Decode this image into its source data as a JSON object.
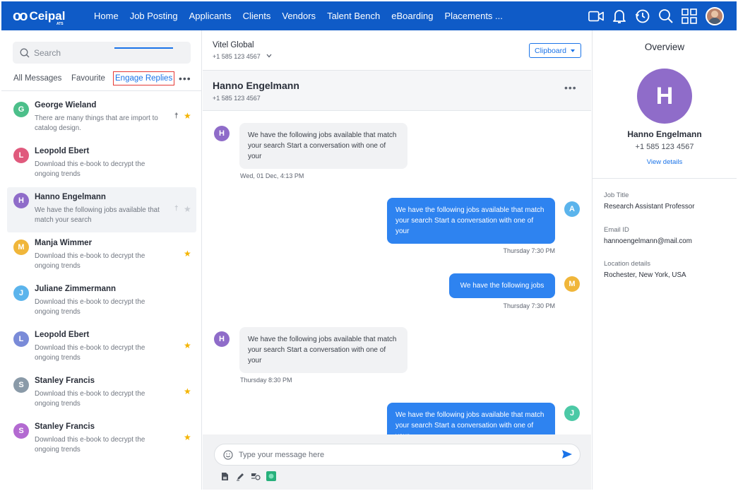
{
  "brand": {
    "name": "Ceipal",
    "sub": "ATS"
  },
  "nav": [
    "Home",
    "Job Posting",
    "Applicants",
    "Clients",
    "Vendors",
    "Talent Bench",
    "eBoarding",
    "Placements ..."
  ],
  "nav_icons": [
    "video-icon",
    "bell-icon",
    "history-icon",
    "search-icon",
    "grid-icon",
    "avatar"
  ],
  "sidebar": {
    "search_placeholder": "Search",
    "tabs": [
      "All Messages",
      "Favourite",
      "Engage Replies"
    ],
    "active_tab": "Engage Replies",
    "contacts": [
      {
        "initial": "G",
        "color": "#4cbf8a",
        "name": "George Wieland",
        "preview": "There are many things that are import to catalog design.",
        "pinned": true,
        "starred": true,
        "selected": false
      },
      {
        "initial": "L",
        "color": "#e05a7d",
        "name": "Leopold Ebert",
        "preview": "Download this e-book to decrypt the ongoing trends",
        "pinned": false,
        "starred": false,
        "selected": false
      },
      {
        "initial": "H",
        "color": "#8f6cc9",
        "name": "Hanno Engelmann",
        "preview": "We have the following jobs available that match your search",
        "pinned": true,
        "starred": true,
        "selected": true
      },
      {
        "initial": "M",
        "color": "#f0b63a",
        "name": "Manja Wimmer",
        "preview": "Download this e-book to decrypt the ongoing trends",
        "pinned": false,
        "starred": true,
        "selected": false
      },
      {
        "initial": "J",
        "color": "#5bb4ec",
        "name": "Juliane Zimmermann",
        "preview": "Download this e-book to decrypt the ongoing trends",
        "pinned": false,
        "starred": false,
        "selected": false
      },
      {
        "initial": "L",
        "color": "#7a8bd8",
        "name": "Leopold Ebert",
        "preview": "Download this e-book to decrypt the ongoing trends",
        "pinned": false,
        "starred": true,
        "selected": false
      },
      {
        "initial": "S",
        "color": "#8a9aa8",
        "name": "Stanley Francis",
        "preview": "Download this e-book to decrypt the ongoing trends",
        "pinned": false,
        "starred": true,
        "selected": false
      },
      {
        "initial": "S",
        "color": "#b36ad1",
        "name": "Stanley Francis",
        "preview": "Download this e-book to decrypt the ongoing trends",
        "pinned": false,
        "starred": true,
        "selected": false
      }
    ]
  },
  "conversation": {
    "company": "Vitel Global",
    "company_phone": "+1 585 123 4567",
    "clipboard_label": "Clipboard",
    "contact_name": "Hanno Engelmann",
    "contact_phone": "+1 585 123 4567",
    "messages": [
      {
        "dir": "in",
        "initial": "H",
        "color": "#8f6cc9",
        "text": "We have the following jobs available that match your search Start a conversation with one of your",
        "time": "Wed, 01 Dec, 4:13 PM"
      },
      {
        "dir": "out",
        "initial": "A",
        "color": "#5bb4ec",
        "text": "We have the following jobs available that match your search Start a conversation with one of your",
        "time": "Thursday 7:30 PM"
      },
      {
        "dir": "out",
        "initial": "M",
        "color": "#f0b63a",
        "text": "We have the following jobs",
        "time": "Thursday 7:30 PM"
      },
      {
        "dir": "in",
        "initial": "H",
        "color": "#8f6cc9",
        "text": "We have the following jobs available that match your search Start a conversation with one of your",
        "time": "Thursday 8:30 PM"
      },
      {
        "dir": "out",
        "initial": "J",
        "color": "#4cc9a6",
        "text": "We have the following jobs available that match your search Start a conversation with one of your",
        "time": ""
      }
    ],
    "composer_placeholder": "Type your message here"
  },
  "overview": {
    "title": "Overview",
    "initial": "H",
    "name": "Hanno Engelmann",
    "phone": "+1 585 123 4567",
    "view_details": "View details",
    "fields": [
      {
        "label": "Job Title",
        "value": "Research Assistant Professor"
      },
      {
        "label": "Email ID",
        "value": "hannoengelmann@mail.com"
      },
      {
        "label": "Location details",
        "value": "Rochester, New York, USA"
      }
    ]
  }
}
